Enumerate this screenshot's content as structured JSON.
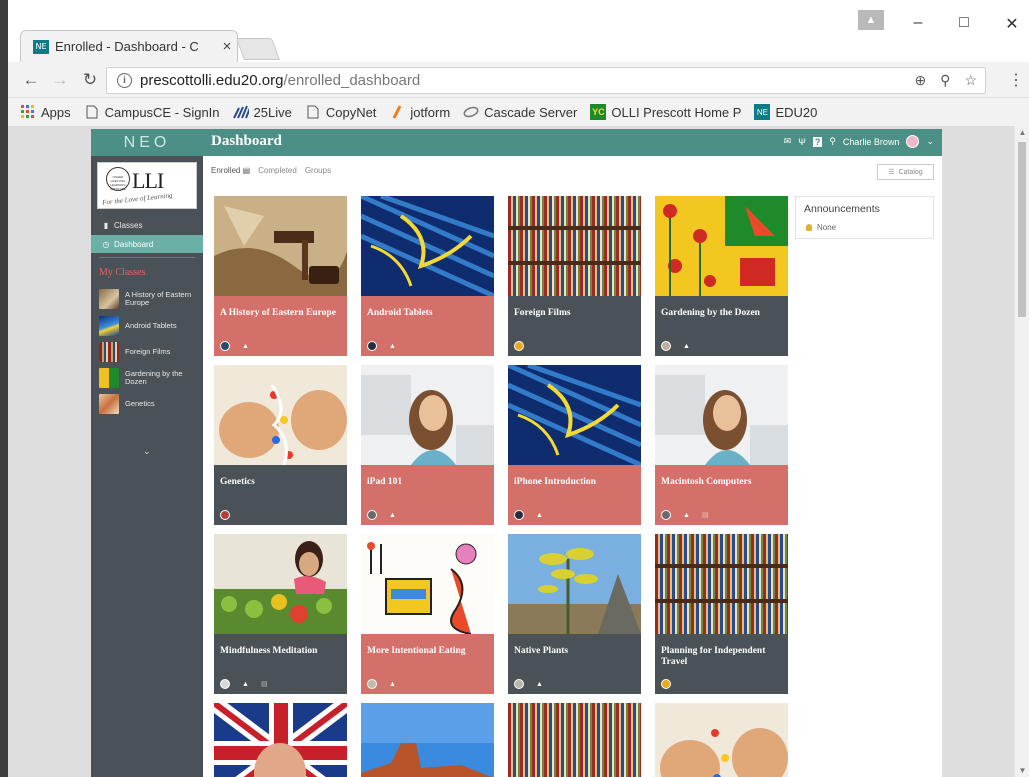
{
  "browser": {
    "tab_title": "Enrolled - Dashboard - C",
    "tab_favicon": "NE",
    "tab_close": "×",
    "url_host": "prescottolli.edu20.org",
    "url_path": "/enrolled_dashboard",
    "bookmarks": [
      {
        "label": "Apps",
        "icon": "apps-grid-icon"
      },
      {
        "label": "CampusCE - SignIn",
        "icon": "page-icon"
      },
      {
        "label": "25Live",
        "icon": "25live-icon"
      },
      {
        "label": "CopyNet",
        "icon": "page-icon"
      },
      {
        "label": "jotform",
        "icon": "jotform-icon"
      },
      {
        "label": "Cascade Server",
        "icon": "cascade-icon"
      },
      {
        "label": "OLLI Prescott Home P",
        "icon": "yc-icon"
      },
      {
        "label": "EDU20",
        "icon": "ne-icon"
      }
    ]
  },
  "app": {
    "logo": "NEO",
    "title": "Dashboard",
    "user_name": "Charlie Brown",
    "accent": "#4c8f86",
    "salmon": "#d4706a",
    "slate": "#4a5257"
  },
  "sidebar": {
    "logo_text": "LLI",
    "logo_circle": "OSHER LIFELONG LEARNING INSTITUTE",
    "logo_tagline": "For the Love of Learning",
    "links": [
      {
        "label": "Classes",
        "icon": "classes-icon"
      },
      {
        "label": "Dashboard",
        "icon": "dashboard-icon"
      }
    ],
    "section_title": "My Classes",
    "classes": [
      {
        "label": "A History of Eastern Europe"
      },
      {
        "label": "Android Tablets"
      },
      {
        "label": "Foreign Films"
      },
      {
        "label": "Gardening by the Dozen"
      },
      {
        "label": "Genetics"
      }
    ],
    "more": "⌄"
  },
  "subnav": {
    "enrolled": "Enrolled",
    "completed": "Completed",
    "groups": "Groups",
    "catalog": "Catalog"
  },
  "announcements": {
    "title": "Announcements",
    "none": "None"
  },
  "cards": [
    {
      "title": "A History of Eastern Europe",
      "color": "salmon"
    },
    {
      "title": "Android Tablets",
      "color": "salmon"
    },
    {
      "title": "Foreign Films",
      "color": "slate"
    },
    {
      "title": "Gardening by the Dozen",
      "color": "slate"
    },
    {
      "title": "Genetics",
      "color": "slate"
    },
    {
      "title": "iPad 101",
      "color": "salmon"
    },
    {
      "title": "iPhone Introduction",
      "color": "salmon"
    },
    {
      "title": "Macintosh Computers",
      "color": "salmon"
    },
    {
      "title": "Mindfulness Meditation",
      "color": "slate"
    },
    {
      "title": "More Intentional Eating",
      "color": "salmon"
    },
    {
      "title": "Native Plants",
      "color": "slate"
    },
    {
      "title": "Planning for Independent Travel",
      "color": "slate"
    }
  ]
}
